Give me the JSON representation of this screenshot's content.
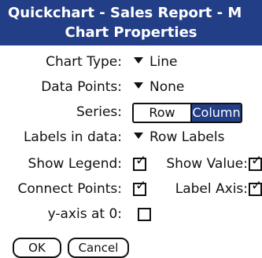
{
  "header": {
    "app_title": "Quickchart - Sales Report - M",
    "dialog_title": "Chart Properties"
  },
  "form": {
    "chart_type": {
      "label": "Chart Type:",
      "value": "Line"
    },
    "data_points": {
      "label": "Data Points:",
      "value": "None"
    },
    "series": {
      "label": "Series:",
      "options": [
        "Row",
        "Column"
      ],
      "selected": "Column"
    },
    "labels_in_data": {
      "label": "Labels in data:",
      "value": "Row Labels"
    },
    "show_legend": {
      "label": "Show Legend:",
      "checked": true
    },
    "show_value": {
      "label": "Show Value:",
      "checked": true
    },
    "connect_points": {
      "label": "Connect Points:",
      "checked": true
    },
    "label_axis": {
      "label": "Label Axis:",
      "checked": true
    },
    "y_axis_at_0": {
      "label": "y-axis at 0:",
      "checked": false
    }
  },
  "buttons": {
    "ok": "OK",
    "cancel": "Cancel"
  },
  "colors": {
    "accent": "#223e86",
    "background": "#ffffff",
    "text": "#111111"
  }
}
